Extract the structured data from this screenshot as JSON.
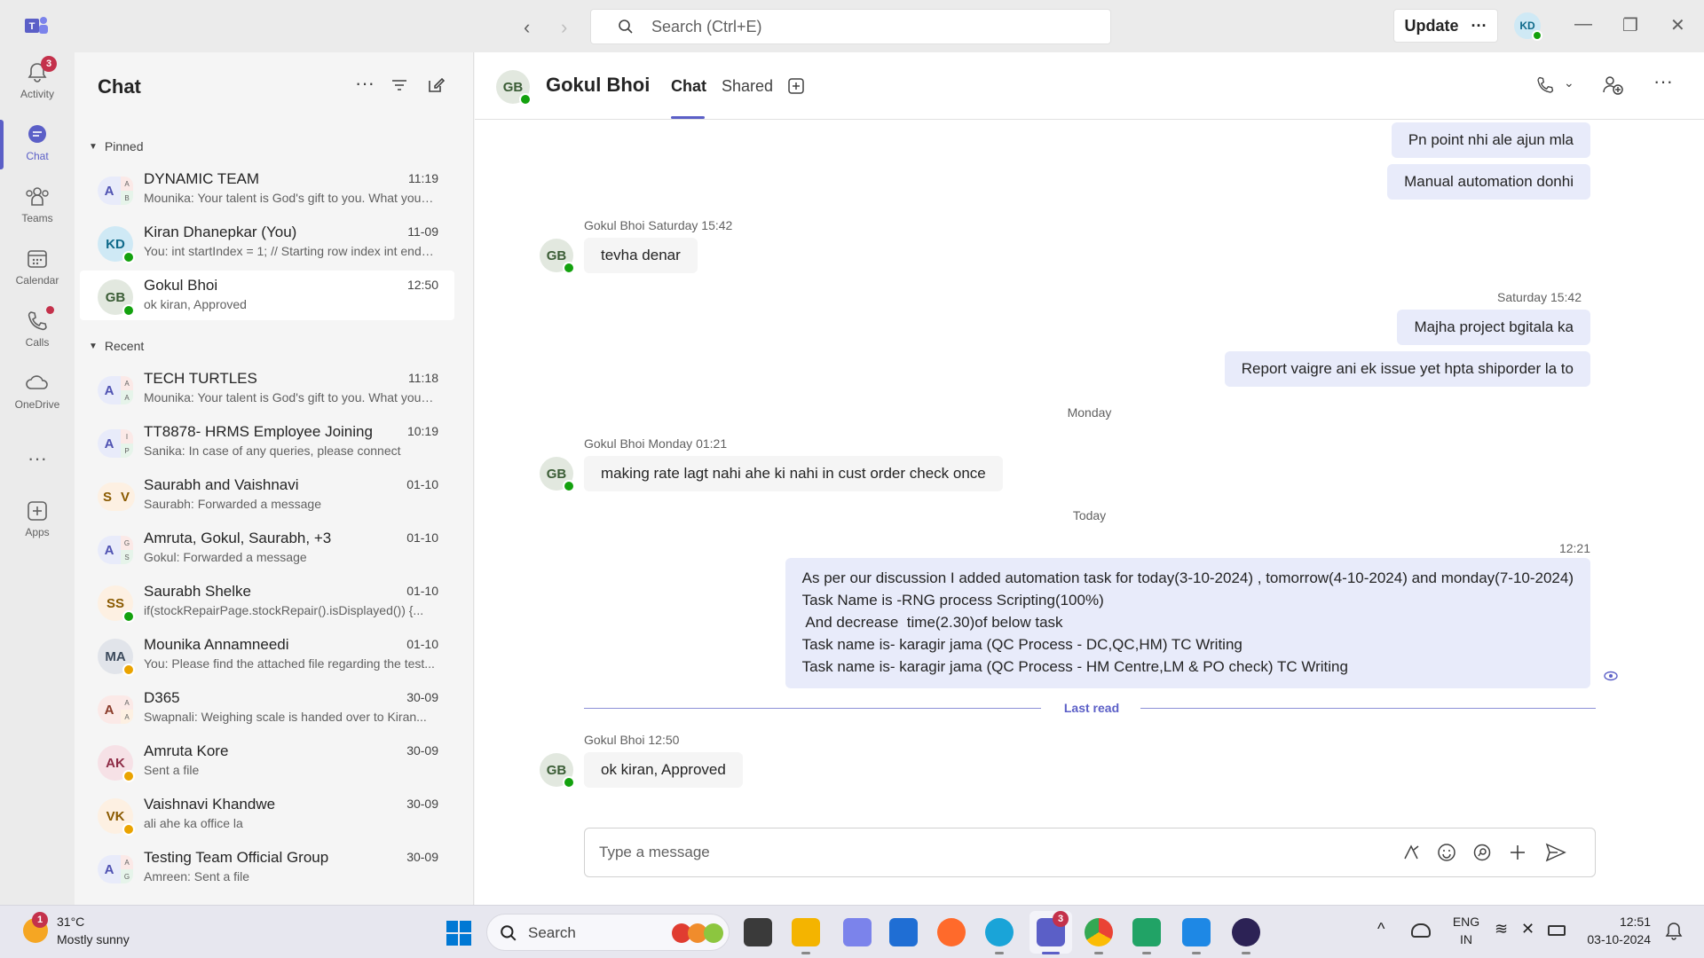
{
  "titlebar": {
    "search_placeholder": "Search (Ctrl+E)",
    "update_label": "Update",
    "user_initials": "KD"
  },
  "rail": {
    "items": [
      {
        "label": "Activity",
        "badge": "3"
      },
      {
        "label": "Chat"
      },
      {
        "label": "Teams"
      },
      {
        "label": "Calendar"
      },
      {
        "label": "Calls"
      },
      {
        "label": "OneDrive"
      },
      {
        "label": "Apps"
      }
    ]
  },
  "chatlist": {
    "title": "Chat",
    "pinned_label": "Pinned",
    "recent_label": "Recent",
    "pinned": [
      {
        "name": "DYNAMIC TEAM",
        "time": "11:19",
        "preview": "Mounika: Your talent is God's gift to you. What you do...",
        "avatar": "A",
        "sub1": "A",
        "sub2": "B"
      },
      {
        "name": "Kiran Dhanepkar (You)",
        "time": "11-09",
        "preview": "You: int startIndex = 1; // Starting row index int endIndex...",
        "avatar": "KD"
      },
      {
        "name": "Gokul Bhoi",
        "time": "12:50",
        "preview": "ok kiran, Approved",
        "avatar": "GB"
      }
    ],
    "recent": [
      {
        "name": "TECH TURTLES",
        "time": "11:18",
        "preview": "Mounika: Your talent is God's gift to you. What you do...",
        "avatar": "A",
        "sub1": "A",
        "sub2": "A"
      },
      {
        "name": "TT8878- HRMS Employee Joining",
        "time": "10:19",
        "preview": "Sanika: In case of any queries, please connect",
        "avatar": "A",
        "sub1": "I",
        "sub2": "P"
      },
      {
        "name": "Saurabh and Vaishnavi",
        "time": "01-10",
        "preview": "Saurabh: Forwarded a message",
        "left": "S",
        "right": "V"
      },
      {
        "name": "Amruta, Gokul, Saurabh, +3",
        "time": "01-10",
        "preview": "Gokul: Forwarded a message",
        "avatar": "A",
        "sub1": "G",
        "sub2": "S"
      },
      {
        "name": "Saurabh Shelke",
        "time": "01-10",
        "preview": "if(stockRepairPage.stockRepair().isDisplayed()) {...",
        "avatar": "SS"
      },
      {
        "name": "Mounika Annamneedi",
        "time": "01-10",
        "preview": "You: Please find the attached file regarding the test...",
        "avatar": "MA"
      },
      {
        "name": "D365",
        "time": "30-09",
        "preview": "Swapnali: Weighing scale is handed over to Kiran...",
        "avatar": "A",
        "sub1": "A",
        "sub2": "A"
      },
      {
        "name": "Amruta Kore",
        "time": "30-09",
        "preview": "Sent a file",
        "avatar": "AK"
      },
      {
        "name": "Vaishnavi Khandwe",
        "time": "30-09",
        "preview": "ali ahe ka office la",
        "avatar": "VK"
      },
      {
        "name": "Testing Team Official Group",
        "time": "30-09",
        "preview": "Amreen: Sent a file",
        "avatar": "A",
        "sub1": "A",
        "sub2": "G"
      }
    ]
  },
  "conversation": {
    "contact_name": "Gokul Bhoi",
    "contact_initials": "GB",
    "tabs": [
      "Chat",
      "Shared"
    ],
    "messages": {
      "out1": "Pn point nhi ale ajun mla",
      "out2": "Manual automation donhi",
      "in1_meta": "Gokul Bhoi   Saturday 15:42",
      "in1_text": "tevha denar",
      "out_time_sat": "Saturday 15:42",
      "out3": "Majha project bgitala ka",
      "out4": "Report vaigre ani ek issue yet hpta shiporder la to",
      "day_monday": "Monday",
      "in2_meta": "Gokul Bhoi   Monday 01:21",
      "in2_text": "making rate lagt nahi ahe ki nahi in cust order check once",
      "day_today": "Today",
      "out_time_today": "12:21",
      "out5_lines": [
        "As per our discussion I added automation task for today(3-10-2024) , tomorrow(4-10-2024) and monday(7-10-2024)",
        "Task Name is -RNG process Scripting(100%)",
        " And decrease  time(2.30)of below task",
        "Task name is- karagir jama (QC Process - DC,QC,HM) TC Writing",
        "Task name is- karagir jama (QC Process - HM Centre,LM & PO check) TC Writing"
      ],
      "last_read": "Last read",
      "in3_meta": "Gokul Bhoi   12:50",
      "in3_text": "ok kiran, Approved"
    },
    "composer_placeholder": "Type a message"
  },
  "taskbar": {
    "weather_temp": "31°C",
    "weather_desc": "Mostly sunny",
    "weather_badge": "1",
    "search_label": "Search",
    "teams_badge": "3",
    "lang_line1": "ENG",
    "lang_line2": "IN",
    "clock_time": "12:51",
    "clock_date": "03-10-2024"
  },
  "colors": {
    "accent": "#5b5fc7",
    "presence_available": "#13a10e",
    "presence_away": "#eaa300",
    "badge_red": "#c4314b",
    "bubble_out": "#e8ebfa"
  }
}
